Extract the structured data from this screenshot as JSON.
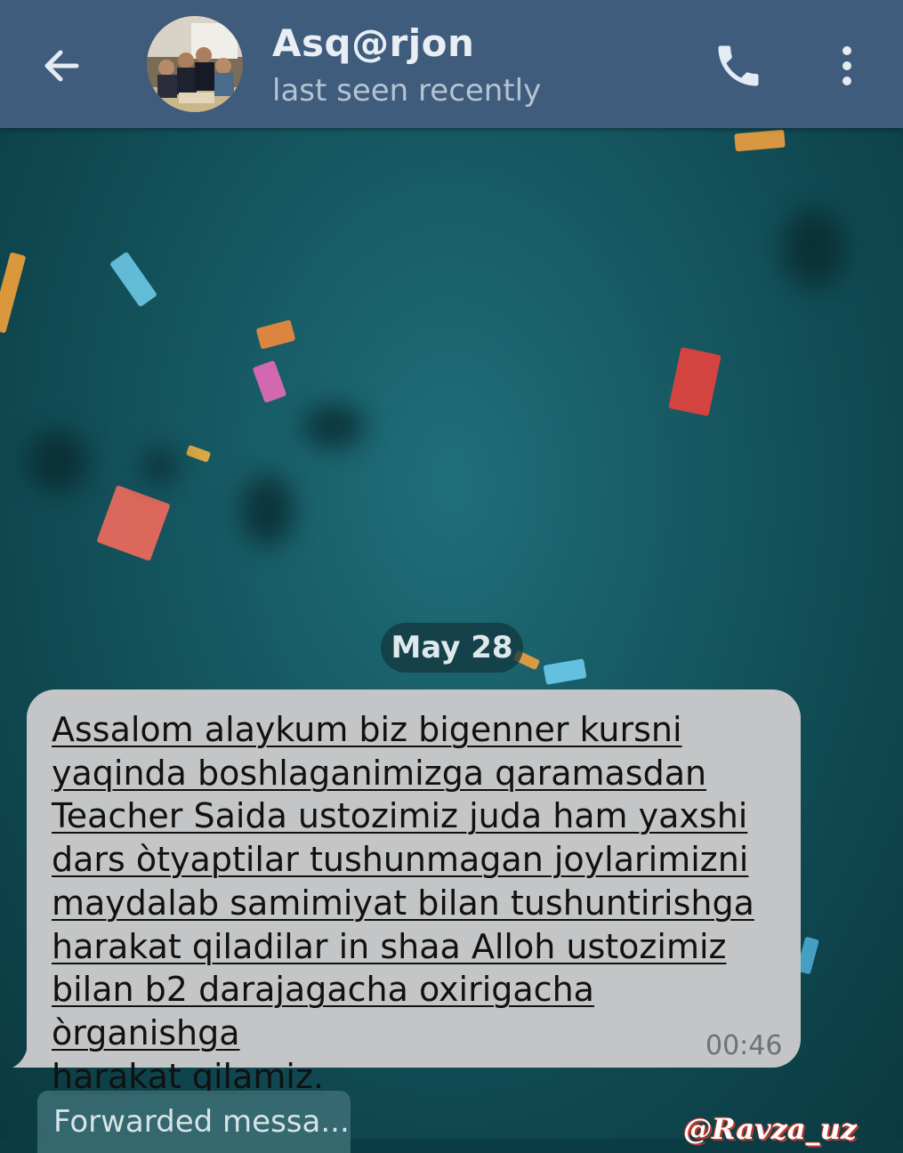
{
  "header": {
    "contact_name": "Asq@rjon",
    "status": "last seen recently"
  },
  "chat": {
    "date_separator": "May 28",
    "message": {
      "text": "Assalom alaykum biz bigenner kursni\nyaqinda boshlaganimizga qaramasdan\nTeacher Saida ustozimiz juda ham yaxshi\ndars òtyaptilar tushunmagan joylarimizni\nmaydalab samimiyat bilan tushuntirishga\nharakat qiladilar in shaa Alloh ustozimiz\nbilan b2 darajagacha oxirigacha òrganishga\nharakat qilamiz.",
      "time": "00:46"
    },
    "forwarded_preview": "Forwarded messa..."
  },
  "watermark": "@Ravza_uz",
  "icons": {
    "back": "arrow-left-icon",
    "call": "phone-icon",
    "menu": "more-vertical-icon"
  },
  "colors": {
    "header": "#3f5c7d",
    "bubble": "#c3c5c6",
    "wallpaper": "#175a64"
  }
}
